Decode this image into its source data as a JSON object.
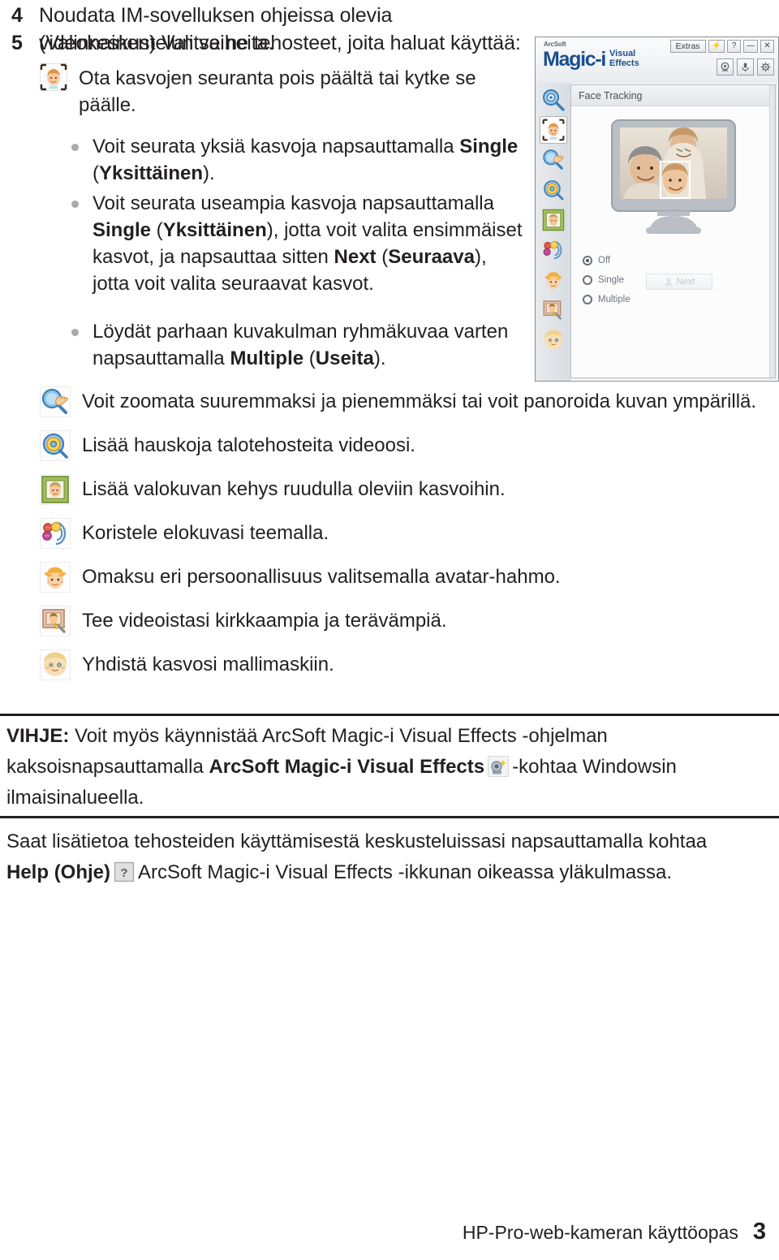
{
  "document": {
    "steps": [
      {
        "num": "4",
        "text": "Noudata IM-sovelluksen ohjeissa olevia videokeskustelun vaiheita."
      },
      {
        "num": "5",
        "text": "(Valinnainen) Valitse ne tehosteet, joita haluat käyttää:"
      }
    ],
    "face_tracking_item": {
      "icon": "face-tracking-icon",
      "text": "Ota kasvojen seuranta pois päältä tai kytke se päälle."
    },
    "bullets": [
      {
        "icon": "bullet-dot",
        "parts": [
          {
            "t": "Voit seurata yksiä kasvoja napsauttamalla ",
            "b": false
          },
          {
            "t": "Single",
            "b": true
          },
          {
            "t": " (",
            "b": false
          },
          {
            "t": "Yksittäinen",
            "b": true
          },
          {
            "t": ").",
            "b": false
          }
        ]
      },
      {
        "icon": "bullet-dot",
        "parts": [
          {
            "t": "Voit seurata useampia kasvoja napsauttamalla ",
            "b": false
          },
          {
            "t": "Single",
            "b": true
          },
          {
            "t": " (",
            "b": false
          },
          {
            "t": "Yksittäinen",
            "b": true
          },
          {
            "t": "), jotta voit valita ensimmäiset kasvot, ja napsauttaa sitten ",
            "b": false
          },
          {
            "t": "Next",
            "b": true
          },
          {
            "t": " (",
            "b": false
          },
          {
            "t": "Seuraava",
            "b": true
          },
          {
            "t": "), jotta voit valita seuraavat kasvot.",
            "b": false
          }
        ]
      },
      {
        "icon": "bullet-dot",
        "parts": [
          {
            "t": "Löydät parhaan kuvakulman ryhmäkuvaa varten napsauttamalla ",
            "b": false
          },
          {
            "t": "Multiple",
            "b": true
          },
          {
            "t": " (",
            "b": false
          },
          {
            "t": "Useita",
            "b": true
          },
          {
            "t": ").",
            "b": false
          }
        ]
      }
    ],
    "effects": [
      {
        "icon": "zoom-pan-icon",
        "text": "Voit zoomata suuremmaksi ja pienemmäksi tai voit panoroida kuvan ympärillä."
      },
      {
        "icon": "house-effects-icon",
        "text": "Lisää hauskoja talotehosteita videoosi."
      },
      {
        "icon": "photo-frame-icon",
        "text": "Lisää valokuvan kehys ruudulla oleviin kasvoihin."
      },
      {
        "icon": "theme-icon",
        "text": "Koristele elokuvasi teemalla."
      },
      {
        "icon": "avatar-icon",
        "text": "Omaksu eri persoonallisuus valitsemalla avatar-hahmo."
      },
      {
        "icon": "enhance-video-icon",
        "text": "Tee videoistasi kirkkaampia ja terävämpiä."
      },
      {
        "icon": "face-mask-icon",
        "text": "Yhdistä kasvosi mallimaskiin."
      }
    ],
    "tip": {
      "label": "VIHJE:",
      "text_before": " Voit myös käynnistää ArcSoft Magic-i Visual Effects -ohjelman kaksoisnapsauttamalla ",
      "bold_app": "ArcSoft Magic-i Visual Effects",
      "icon": "tray-app-icon",
      "text_after": "-kohtaa Windowsin ilmaisinalueella."
    },
    "help_note": {
      "line1": "Saat lisätietoa tehosteiden käyttämisestä keskusteluissasi napsauttamalla kohtaa",
      "bold_help": "Help",
      "bold_help_fi": "(Ohje)",
      "icon": "help-question-icon",
      "line2_after": "ArcSoft Magic-i Visual Effects -ikkunan oikeassa yläkulmassa."
    },
    "footer": {
      "title": "HP-Pro-web-kameran käyttöopas",
      "page": "3"
    }
  },
  "app_screenshot": {
    "brand": {
      "arcsoft": "ArcSoft",
      "magic": "Magic-i",
      "visual": "Visual",
      "effects": "Effects"
    },
    "window_buttons": [
      {
        "name": "extras-button",
        "label": "Extras"
      },
      {
        "name": "lightning-button",
        "label": "⚡"
      },
      {
        "name": "help-button",
        "label": "?"
      },
      {
        "name": "minimize-button",
        "label": "—"
      },
      {
        "name": "close-button",
        "label": "✕"
      }
    ],
    "tool_buttons": [
      {
        "name": "camera-button",
        "label": "camera-icon"
      },
      {
        "name": "microphone-button",
        "label": "microphone-icon"
      },
      {
        "name": "settings-button",
        "label": "gear-icon"
      }
    ],
    "panel_title": "Face Tracking",
    "sidebar_icons": [
      "magnifier-settings-icon",
      "face-tracking-icon",
      "zoom-pan-icon",
      "house-effects-icon",
      "photo-frame-icon",
      "theme-icon",
      "avatar-icon",
      "enhance-video-icon",
      "face-mask-icon"
    ],
    "selected_sidebar_index": 1,
    "radios": [
      {
        "label": "Off",
        "selected": true
      },
      {
        "label": "Single",
        "selected": false
      },
      {
        "label": "Multiple",
        "selected": false
      }
    ],
    "next_button": {
      "label": "Next",
      "disabled": true
    },
    "colors": {
      "brand_blue": "#1b4f8f",
      "window_bg": "#eef0f2",
      "panel_bg": "#fcfcfd"
    }
  }
}
